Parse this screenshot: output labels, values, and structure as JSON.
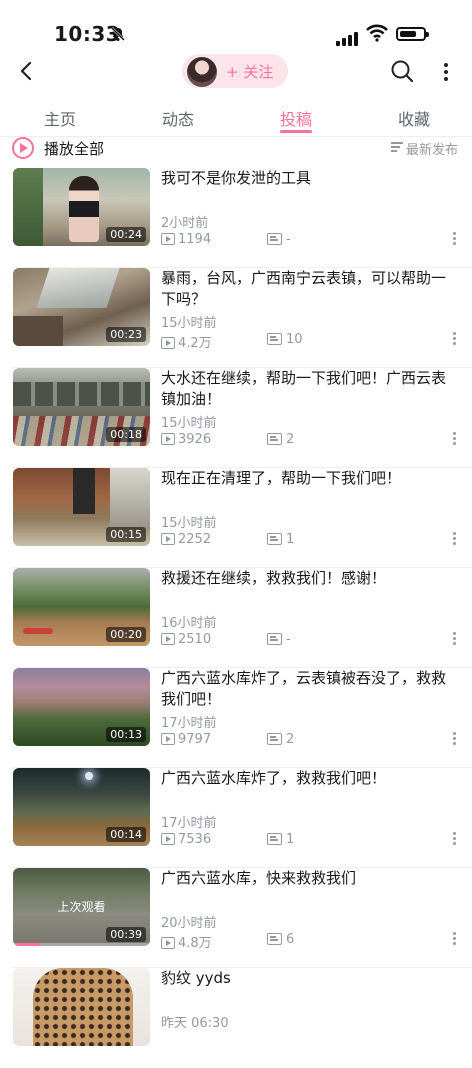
{
  "status_bar": {
    "time": "10:33"
  },
  "header": {
    "follow_label": "+ 关注"
  },
  "tabs": [
    {
      "label": "主页"
    },
    {
      "label": "动态"
    },
    {
      "label": "投稿"
    },
    {
      "label": "收藏"
    }
  ],
  "active_tab": "投稿",
  "toolbar": {
    "play_all": "播放全部",
    "sort": "最新发布"
  },
  "videos": [
    {
      "title": "我可不是你发泄的工具",
      "time": "2小时前",
      "plays": "1194",
      "danmaku": "-",
      "duration": "00:24"
    },
    {
      "title": "暴雨，台风，广西南宁云表镇，可以帮助一下吗？",
      "time": "15小时前",
      "plays": "4.2万",
      "danmaku": "10",
      "duration": "00:23"
    },
    {
      "title": "大水还在继续，帮助一下我们吧！广西云表镇加油！",
      "time": "15小时前",
      "plays": "3926",
      "danmaku": "2",
      "duration": "00:18"
    },
    {
      "title": "现在正在清理了，帮助一下我们吧！",
      "time": "15小时前",
      "plays": "2252",
      "danmaku": "1",
      "duration": "00:15"
    },
    {
      "title": "救援还在继续，救救我们！感谢！",
      "time": "16小时前",
      "plays": "2510",
      "danmaku": "-",
      "duration": "00:20"
    },
    {
      "title": "广西六蓝水库炸了，云表镇被吞没了，救救我们吧！",
      "time": "17小时前",
      "plays": "9797",
      "danmaku": "2",
      "duration": "00:13"
    },
    {
      "title": "广西六蓝水库炸了，救救我们吧！",
      "time": "17小时前",
      "plays": "7536",
      "danmaku": "1",
      "duration": "00:14"
    },
    {
      "title": "广西六蓝水库，快来救救我们",
      "time": "20小时前",
      "plays": "4.8万",
      "danmaku": "6",
      "duration": "00:39",
      "last_watched": "上次观看",
      "watch_progress": 0.2
    },
    {
      "title": "豹纹 yyds",
      "time": "昨天 06:30",
      "plays": "",
      "danmaku": "",
      "duration": ""
    }
  ]
}
